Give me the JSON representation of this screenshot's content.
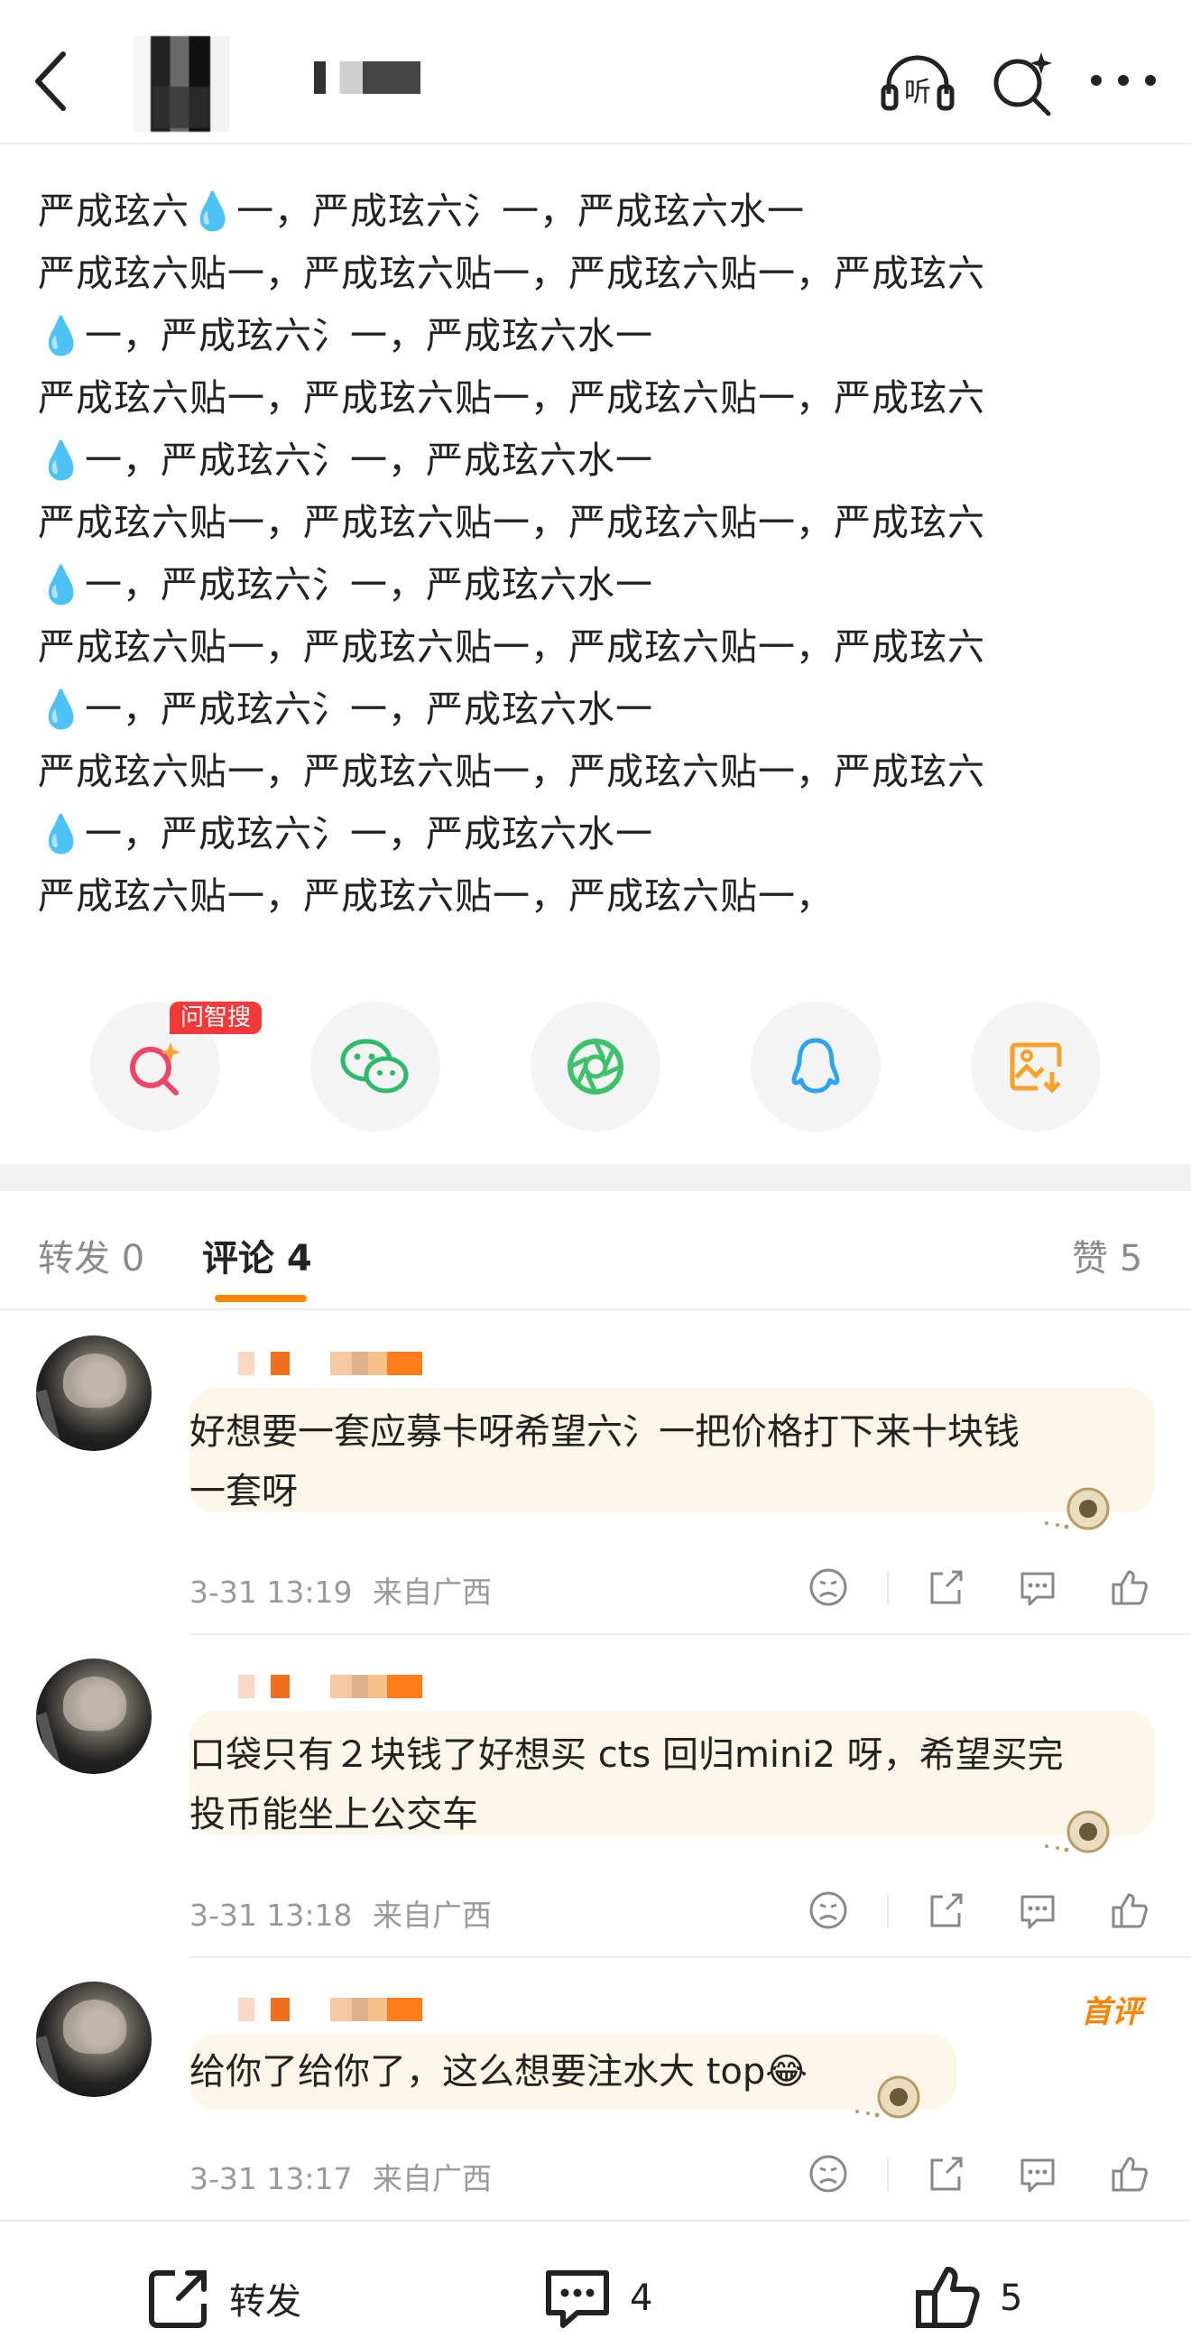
{
  "post": {
    "lines": [
      "严成玹六💧一，严成玹六氵一，严成玹六水一",
      "严成玹六贴一，严成玹六贴一，严成玹六贴一，严成玹六",
      "💧一，严成玹六氵一，严成玹六水一",
      "严成玹六贴一，严成玹六贴一，严成玹六贴一，严成玹六",
      "💧一，严成玹六氵一，严成玹六水一",
      "严成玹六贴一，严成玹六贴一，严成玹六贴一，严成玹六",
      "💧一，严成玹六氵一，严成玹六水一",
      "严成玹六贴一，严成玹六贴一，严成玹六贴一，严成玹六",
      "💧一，严成玹六氵一，严成玹六水一",
      "严成玹六贴一，严成玹六贴一，严成玹六贴一，严成玹六",
      "💧一，严成玹六氵一，严成玹六水一",
      "严成玹六贴一，严成玹六贴一，严成玹六贴一，"
    ]
  },
  "header": {
    "listen_label": "听"
  },
  "share": {
    "badge": "问智搜",
    "items": [
      "search-ai-icon",
      "wechat-icon",
      "moments-icon",
      "qq-icon",
      "save-image-icon"
    ]
  },
  "tabs": {
    "repost": "转发 0",
    "comments": "评论 4",
    "likes": "赞 5"
  },
  "comments": [
    {
      "text_line1": "好想要一套应募卡呀希望六氵一把价格打下来十块钱",
      "text_line2": "一套呀",
      "time": "3-31 13:19",
      "location": "来自广西"
    },
    {
      "text_line1": "口袋只有２块钱了好想买 cts 回归mini2 呀，希望买完",
      "text_line2": "投币能坐上公交车",
      "time": "3-31 13:18",
      "location": "来自广西"
    },
    {
      "text_line1": "给你了给你了，这么想要注水大 top😂",
      "text_line2": "",
      "time": "3-31 13:17",
      "location": "来自广西",
      "tag": "首评"
    }
  ],
  "bottom": {
    "repost": "转发",
    "comments": "4",
    "likes": "5"
  },
  "colors": {
    "accent": "#ff8200",
    "badge": "#f23a3a",
    "bubble": "#fbf6e8"
  }
}
